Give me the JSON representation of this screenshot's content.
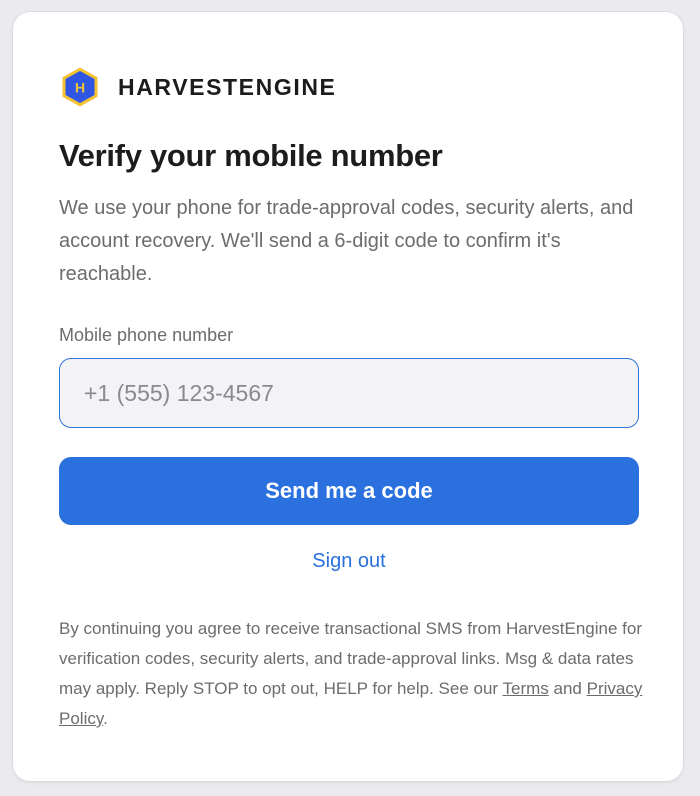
{
  "brand": {
    "name": "HARVESTENGINE",
    "logo_letter": "H",
    "logo_icon": "hexagon-logo-icon",
    "colors": {
      "hex_fill": "#2f56e3",
      "hex_border": "#f1c232",
      "letter": "#f1c232"
    }
  },
  "page": {
    "title": "Verify your mobile number",
    "description": "We use your phone for trade-approval codes, security alerts, and account recovery. We'll send a 6-digit code to confirm it's reachable."
  },
  "phone": {
    "label": "Mobile phone number",
    "placeholder": "+1 (555) 123-4567",
    "value": ""
  },
  "actions": {
    "send_label": "Send me a code",
    "signout_label": "Sign out"
  },
  "legal": {
    "text_before": "By continuing you agree to receive transactional SMS from HarvestEngine for verification codes, security alerts, and trade-approval links. Msg & data rates may apply. Reply STOP to opt out, HELP for help. See our ",
    "terms_label": "Terms",
    "joiner": " and ",
    "privacy_label": "Privacy Policy",
    "text_after": "."
  },
  "colors": {
    "accent": "#2a70df",
    "text_primary": "#1c1c1e",
    "text_secondary": "#6c6c70",
    "input_bg": "#f3f3f5",
    "page_bg": "#ebebef"
  }
}
